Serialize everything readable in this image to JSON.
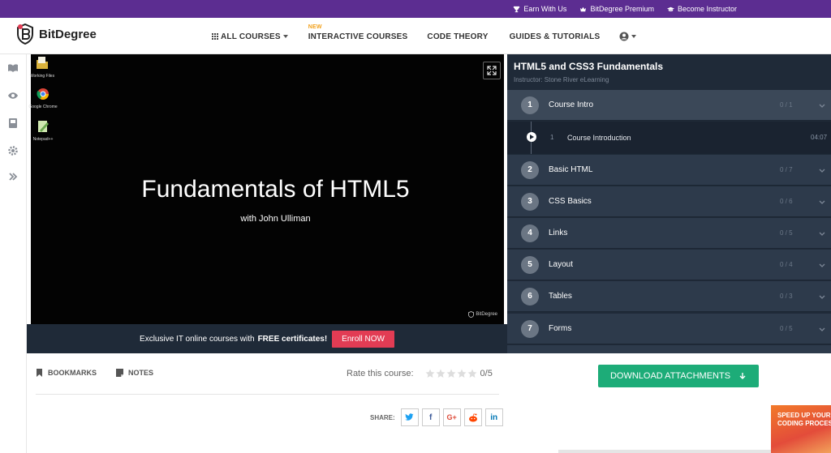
{
  "topbar": {
    "links": [
      {
        "label": "Earn With Us",
        "icon": "trophy-icon"
      },
      {
        "label": "BitDegree Premium",
        "icon": "crown-icon"
      },
      {
        "label": "Become Instructor",
        "icon": "graduation-cap-icon"
      }
    ],
    "bg_color": "#5c2d91"
  },
  "nav": {
    "logo_text": "BitDegree",
    "menu": {
      "all_courses": "ALL COURSES",
      "new_badge": "NEW",
      "interactive": "INTERACTIVE COURSES",
      "code_theory": "CODE THEORY",
      "guides": "GUIDES & TUTORIALS"
    }
  },
  "sidebar": {
    "icons": [
      "book-icon",
      "eye-icon",
      "bookmark-book-icon",
      "gear-icon",
      "double-chevron-right-icon"
    ]
  },
  "video": {
    "desktop_icons": [
      {
        "label": "Working Files",
        "icon": "folder-icon"
      },
      {
        "label": "Google Chrome",
        "icon": "chrome-icon"
      },
      {
        "label": "Notepad++",
        "icon": "notepad-icon"
      }
    ],
    "title": "Fundamentals of HTML5",
    "subtitle": "with John Ulliman",
    "brand": "BitDegree"
  },
  "enroll": {
    "text_before": "Exclusive IT online courses with",
    "text_bold": "FREE certificates!",
    "button": "Enroll NOW",
    "button_color": "#e23c54"
  },
  "panel": {
    "title": "HTML5 and CSS3 Fundamentals",
    "instructor": "Instructor: Stone River eLearning",
    "sections": [
      {
        "num": "1",
        "name": "Course Intro",
        "count": "0 / 1"
      },
      {
        "num": "2",
        "name": "Basic HTML",
        "count": "0 / 7"
      },
      {
        "num": "3",
        "name": "CSS Basics",
        "count": "0 / 6"
      },
      {
        "num": "4",
        "name": "Links",
        "count": "0 / 5"
      },
      {
        "num": "5",
        "name": "Layout",
        "count": "0 / 4"
      },
      {
        "num": "6",
        "name": "Tables",
        "count": "0 / 3"
      },
      {
        "num": "7",
        "name": "Forms",
        "count": "0 / 5"
      }
    ],
    "lesson": {
      "num": "1",
      "name": "Course Introduction",
      "time": "04:07"
    }
  },
  "bottom": {
    "tabs": {
      "bookmarks": "BOOKMARKS",
      "notes": "NOTES"
    },
    "rate_label": "Rate this course:",
    "rate_score": "0/5",
    "share_label": "SHARE:",
    "share_buttons": [
      {
        "icon": "twitter-icon",
        "glyph": "t",
        "color": "#1da1f2"
      },
      {
        "icon": "facebook-icon",
        "glyph": "f",
        "color": "#3b5998"
      },
      {
        "icon": "google-plus-icon",
        "glyph": "G+",
        "color": "#dd4b39"
      },
      {
        "icon": "reddit-icon",
        "glyph": "☻",
        "color": "#ff4500"
      },
      {
        "icon": "linkedin-icon",
        "glyph": "in",
        "color": "#0077b5"
      }
    ]
  },
  "download": {
    "label": "DOWNLOAD ATTACHMENTS",
    "color": "#1dac78"
  },
  "promo": {
    "line1": "SPEED UP YOUR",
    "line2": "CODING PROCESS"
  }
}
